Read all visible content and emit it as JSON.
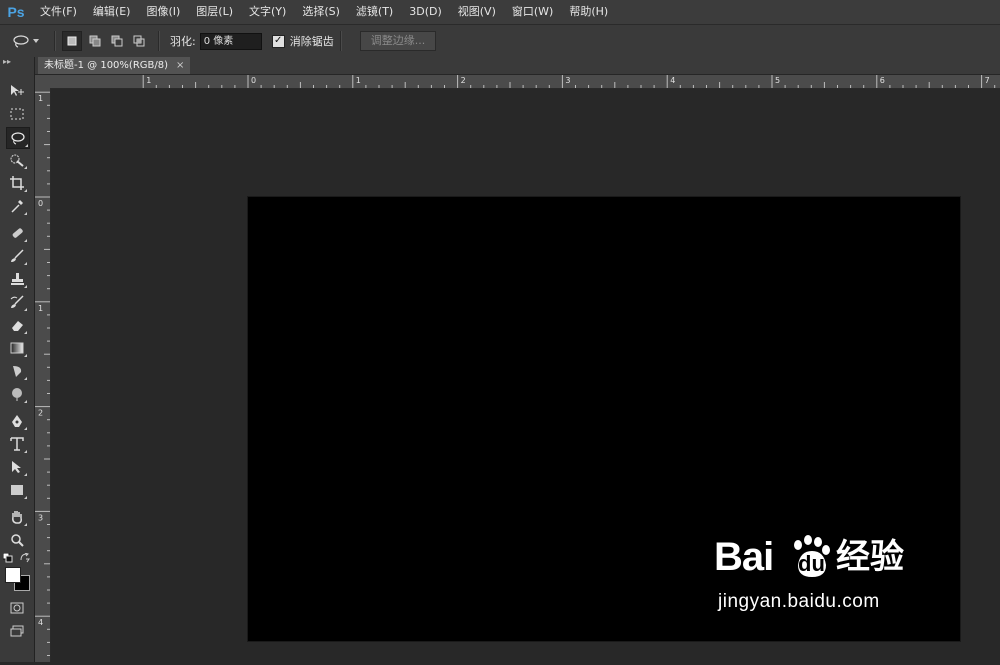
{
  "app": {
    "logo": "Ps"
  },
  "menu": [
    "文件(F)",
    "编辑(E)",
    "图像(I)",
    "图层(L)",
    "文字(Y)",
    "选择(S)",
    "滤镜(T)",
    "3D(D)",
    "视图(V)",
    "窗口(W)",
    "帮助(H)"
  ],
  "options": {
    "feather_label": "羽化:",
    "feather_value": "0 像素",
    "antialias_label": "消除锯齿",
    "antialias_checked": true,
    "refine_edge_label": "调整边缘..."
  },
  "document": {
    "tab_title": "未标题-1 @ 100%(RGB/8)",
    "close_symbol": "×"
  },
  "rulers": {
    "horizontal_labels": [
      "1",
      "0",
      "1",
      "2",
      "3",
      "4",
      "5",
      "6",
      "7"
    ],
    "vertical_labels": [
      "1",
      "0",
      "1",
      "2",
      "3",
      "4"
    ]
  },
  "tools": [
    {
      "name": "move-tool-icon",
      "active": false
    },
    {
      "name": "rectangular-marquee-tool-icon",
      "active": false
    },
    {
      "name": "lasso-tool-icon",
      "active": true
    },
    {
      "name": "quick-selection-tool-icon",
      "active": false
    },
    {
      "name": "crop-tool-icon",
      "active": false
    },
    {
      "name": "eyedropper-tool-icon",
      "active": false
    },
    {
      "name": "healing-brush-tool-icon",
      "active": false
    },
    {
      "name": "brush-tool-icon",
      "active": false
    },
    {
      "name": "clone-stamp-tool-icon",
      "active": false
    },
    {
      "name": "history-brush-tool-icon",
      "active": false
    },
    {
      "name": "eraser-tool-icon",
      "active": false
    },
    {
      "name": "gradient-tool-icon",
      "active": false
    },
    {
      "name": "blur-tool-icon",
      "active": false
    },
    {
      "name": "dodge-tool-icon",
      "active": false
    },
    {
      "name": "pen-tool-icon",
      "active": false
    },
    {
      "name": "type-tool-icon",
      "active": false
    },
    {
      "name": "path-selection-tool-icon",
      "active": false
    },
    {
      "name": "rectangle-tool-icon",
      "active": false
    },
    {
      "name": "hand-tool-icon",
      "active": false
    },
    {
      "name": "zoom-tool-icon",
      "active": false
    }
  ],
  "colors": {
    "foreground": "#ffffff",
    "background": "#000000",
    "canvas": "#000000",
    "accent": "#4ba3e3"
  },
  "watermark": {
    "logo_text": "Bai",
    "logo_du": "du",
    "logo_cn": "经验",
    "url": "jingyan.baidu.com"
  }
}
